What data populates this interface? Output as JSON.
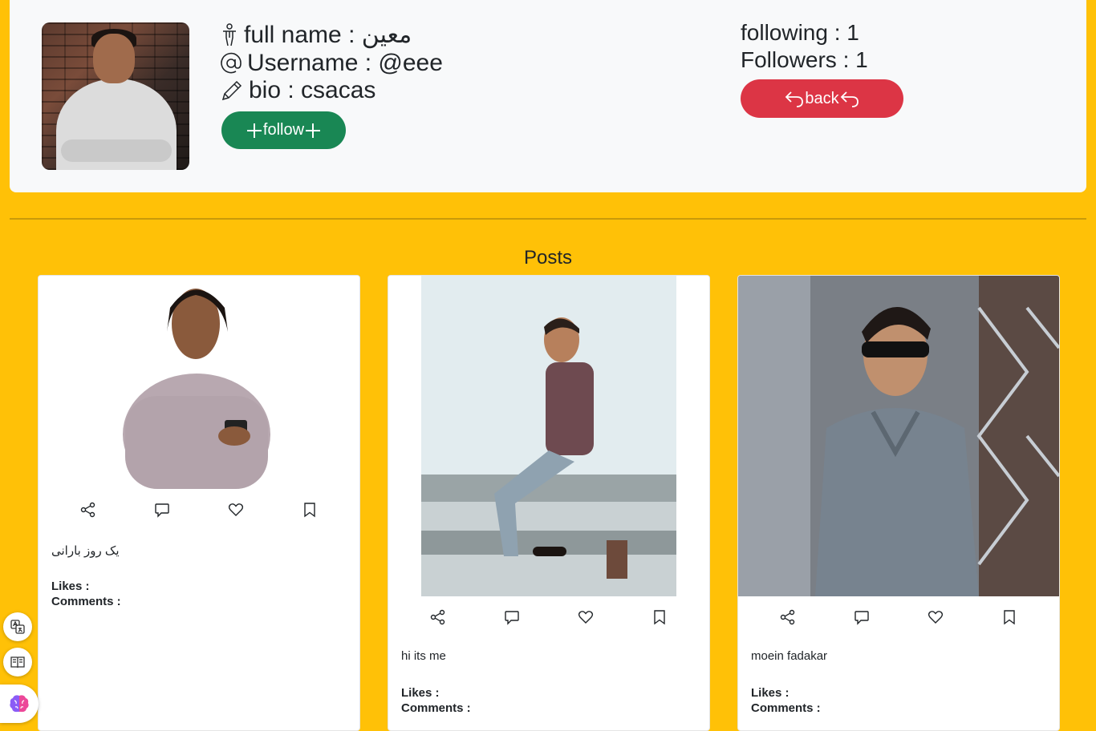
{
  "profile": {
    "full_name_label": "full name : معین",
    "username_label": "Username : @eee",
    "bio_label": "bio : csacas",
    "follow_label": "follow",
    "following_label": "following : 1",
    "followers_label": "Followers : 1",
    "back_label": "back"
  },
  "posts_section": {
    "title": "Posts"
  },
  "posts": [
    {
      "caption": "یک روز بارانی",
      "likes_label": "Likes :",
      "comments_label": "Comments :"
    },
    {
      "caption": "hi its me",
      "likes_label": "Likes :",
      "comments_label": "Comments :"
    },
    {
      "caption": "moein fadakar",
      "likes_label": "Likes :",
      "comments_label": "Comments :"
    }
  ],
  "colors": {
    "page_bg": "#ffc107",
    "card_bg": "#f8f9fa",
    "follow_btn": "#198754",
    "back_btn": "#dc3545"
  },
  "icons": {
    "name": "person-standing-icon",
    "username": "at-sign-icon",
    "bio": "pencil-icon",
    "follow": "plus-icon",
    "back": "reply-arrow-icon",
    "post_actions": [
      "share-icon",
      "comment-icon",
      "heart-icon",
      "bookmark-icon"
    ],
    "side_tools": [
      "translate-icon",
      "reader-icon",
      "brain-icon"
    ]
  }
}
